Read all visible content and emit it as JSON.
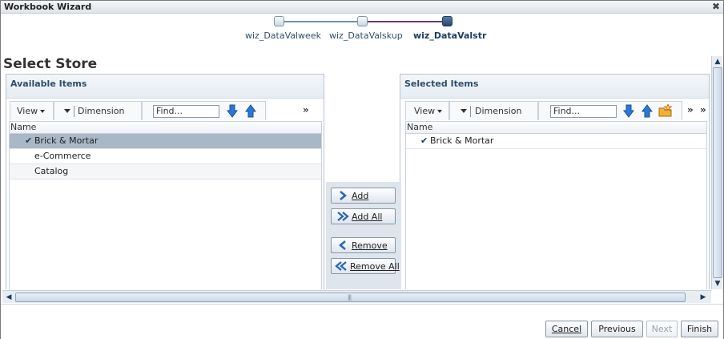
{
  "window": {
    "title": "Workbook Wizard",
    "close_glyph": "✖"
  },
  "train": {
    "steps": [
      {
        "label": "wiz_DataValweek",
        "state": "visited"
      },
      {
        "label": "wiz_DataValskup",
        "state": "visited"
      },
      {
        "label": "wiz_DataValstr",
        "state": "current"
      }
    ]
  },
  "page": {
    "title": "Select Store"
  },
  "available": {
    "title": "Available Items",
    "toolbar": {
      "view_label": "View",
      "dimension_label": "Dimension",
      "find_placeholder": "Find...",
      "overflow_glyph": "»"
    },
    "column_header": "Name",
    "rows": [
      {
        "label": "Brick & Mortar",
        "selected": true,
        "checked": true
      },
      {
        "label": "e-Commerce",
        "selected": false,
        "checked": false
      },
      {
        "label": "Catalog",
        "selected": false,
        "checked": false
      }
    ]
  },
  "selected": {
    "title": "Selected Items",
    "toolbar": {
      "view_label": "View",
      "dimension_label": "Dimension",
      "find_placeholder": "Find...",
      "overflow_glyph": "»"
    },
    "column_header": "Name",
    "rows": [
      {
        "label": "Brick & Mortar",
        "checked": true
      }
    ]
  },
  "shuttle": {
    "add": "Add",
    "add_all": "Add All",
    "remove": "Remove",
    "remove_all": "Remove All"
  },
  "footer": {
    "cancel": "Cancel",
    "previous": "Previous",
    "next": "Next",
    "finish": "Finish",
    "next_disabled": true
  },
  "colors": {
    "panel_title": "#2d4d6d",
    "selected_row": "#a9b7c7",
    "train_current": "#23466f",
    "arrow_blue": "#2a78d6"
  },
  "icons": {
    "check": "✔",
    "move_down": "arrow-down-icon",
    "move_up": "arrow-up-icon",
    "new_folder": "folder-star-icon",
    "scroll_up": "▲",
    "scroll_down": "▼",
    "scroll_left": "◀",
    "scroll_right": "▶"
  }
}
